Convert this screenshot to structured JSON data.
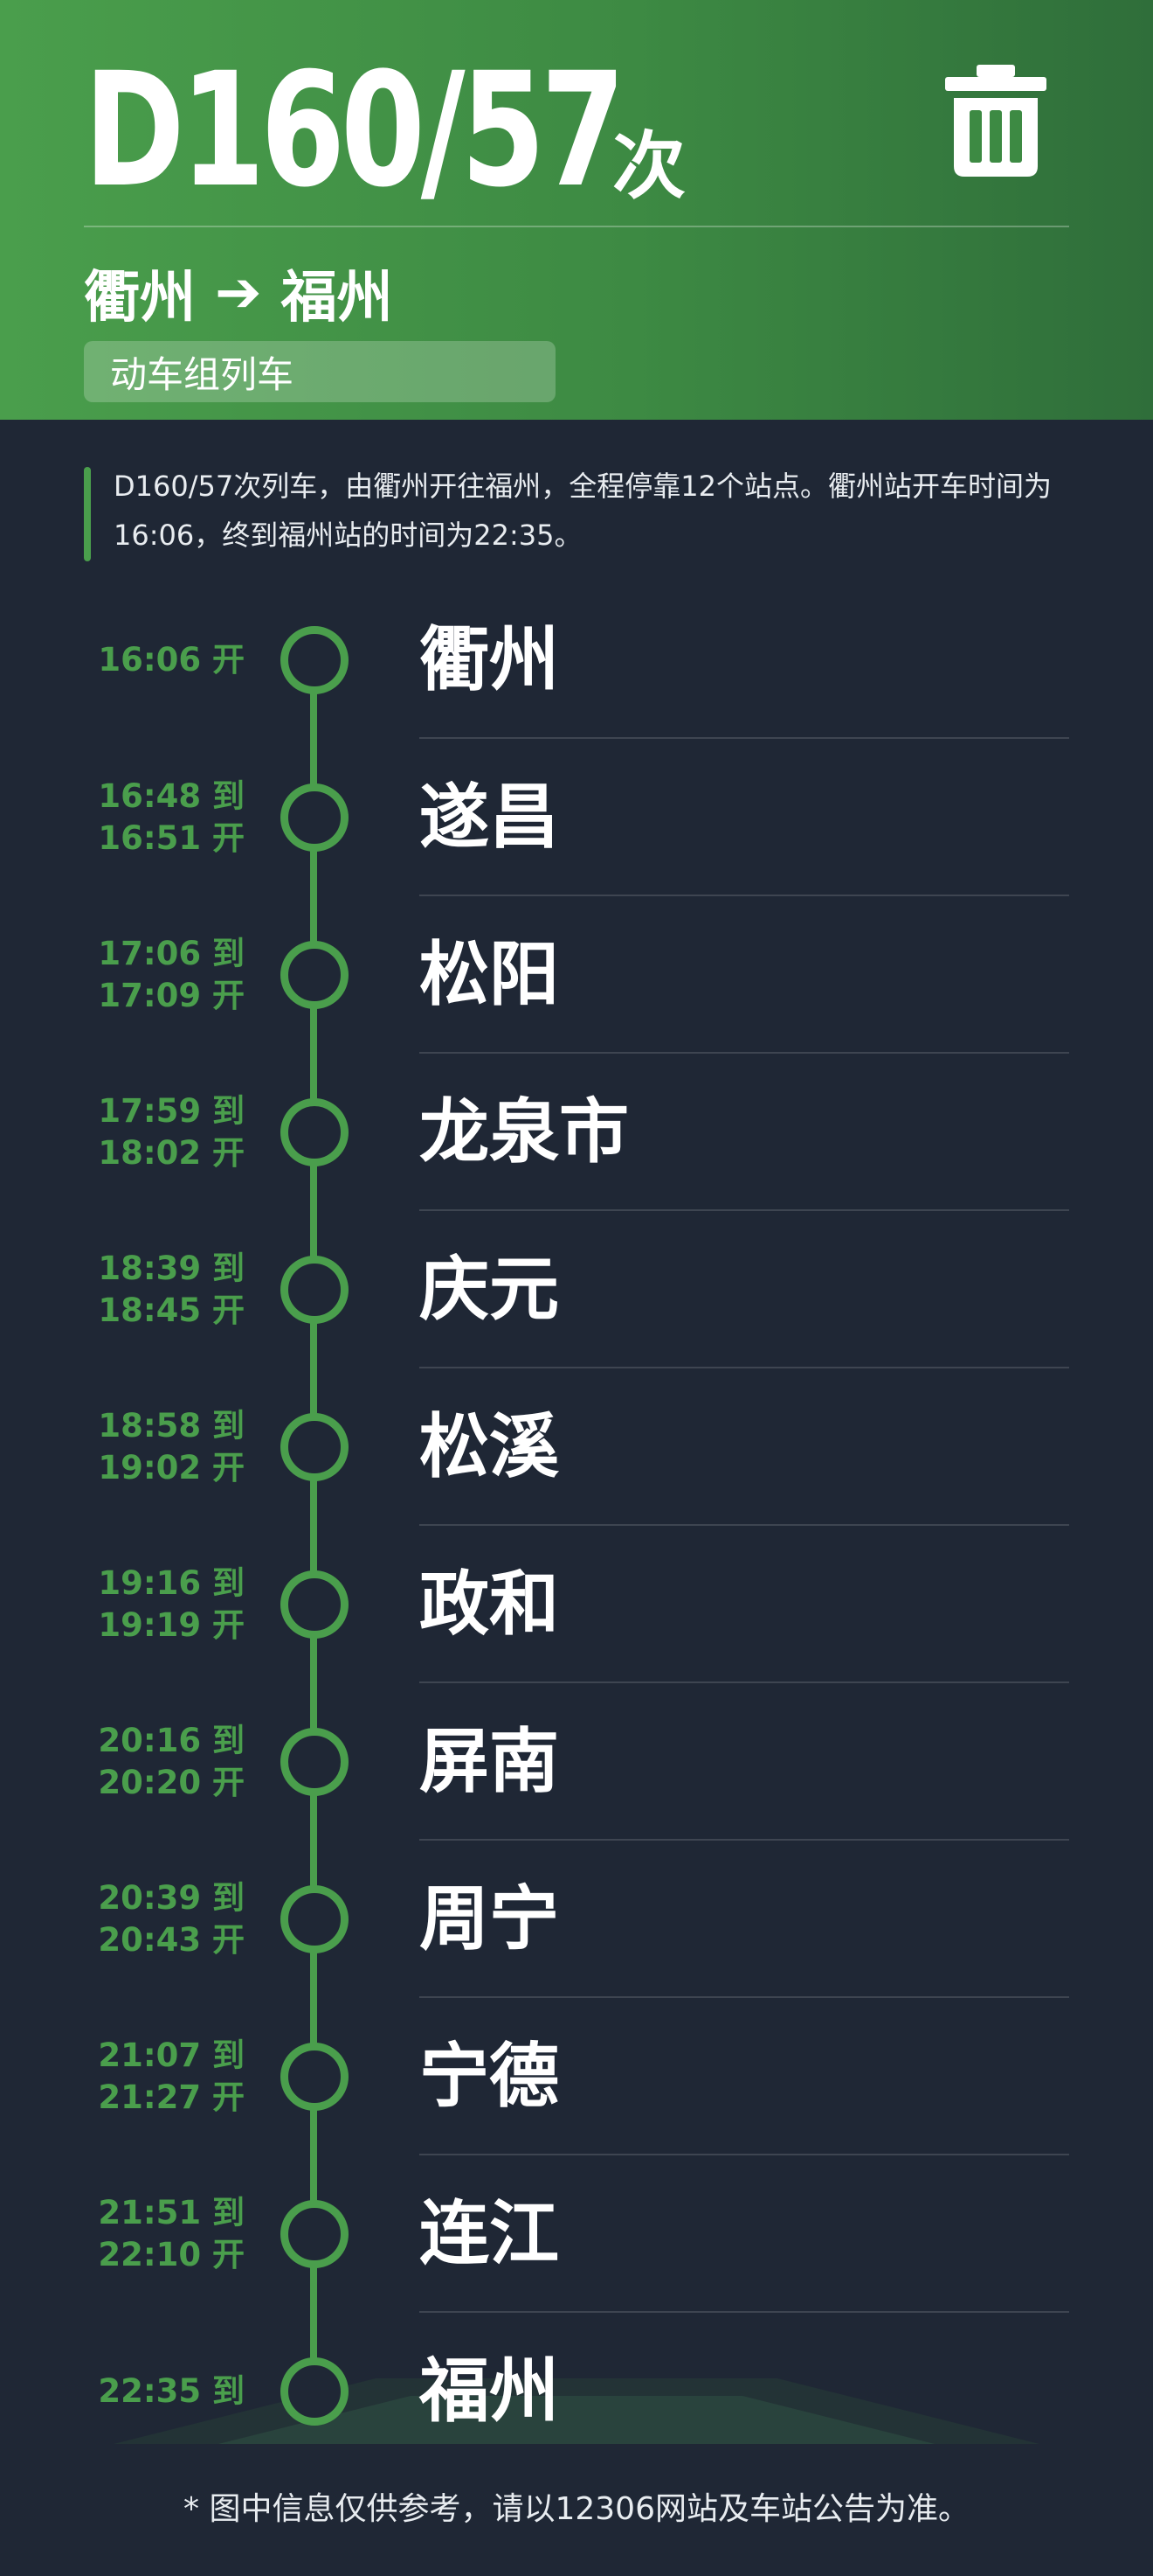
{
  "header": {
    "train_number": "D160/57",
    "train_suffix": "次",
    "from": "衢州",
    "arrow": "➔",
    "to": "福州",
    "train_type": "动车组列车"
  },
  "summary": "D160/57次列车，由衢州开往福州，全程停靠12个站点。衢州站开车时间为16:06，终到福州站的时间为22:35。",
  "stops": [
    {
      "name": "衢州",
      "line1": "16:06 开",
      "line2": ""
    },
    {
      "name": "遂昌",
      "line1": "16:48 到",
      "line2": "16:51 开"
    },
    {
      "name": "松阳",
      "line1": "17:06 到",
      "line2": "17:09 开"
    },
    {
      "name": "龙泉市",
      "line1": "17:59 到",
      "line2": "18:02 开"
    },
    {
      "name": "庆元",
      "line1": "18:39 到",
      "line2": "18:45 开"
    },
    {
      "name": "松溪",
      "line1": "18:58 到",
      "line2": "19:02 开"
    },
    {
      "name": "政和",
      "line1": "19:16 到",
      "line2": "19:19 开"
    },
    {
      "name": "屏南",
      "line1": "20:16 到",
      "line2": "20:20 开"
    },
    {
      "name": "周宁",
      "line1": "20:39 到",
      "line2": "20:43 开"
    },
    {
      "name": "宁德",
      "line1": "21:07 到",
      "line2": "21:27 开"
    },
    {
      "name": "连江",
      "line1": "21:51 到",
      "line2": "22:10 开"
    },
    {
      "name": "福州",
      "line1": "22:35 到",
      "line2": ""
    }
  ],
  "footnote": "* 图中信息仅供参考，请以12306网站及车站公告为准。",
  "colors": {
    "accent": "#4a9e4c",
    "header_dark": "#2f6e3a",
    "background": "#1f2735",
    "text": "#ffffff"
  },
  "icons": {
    "delete": "trash-icon"
  }
}
